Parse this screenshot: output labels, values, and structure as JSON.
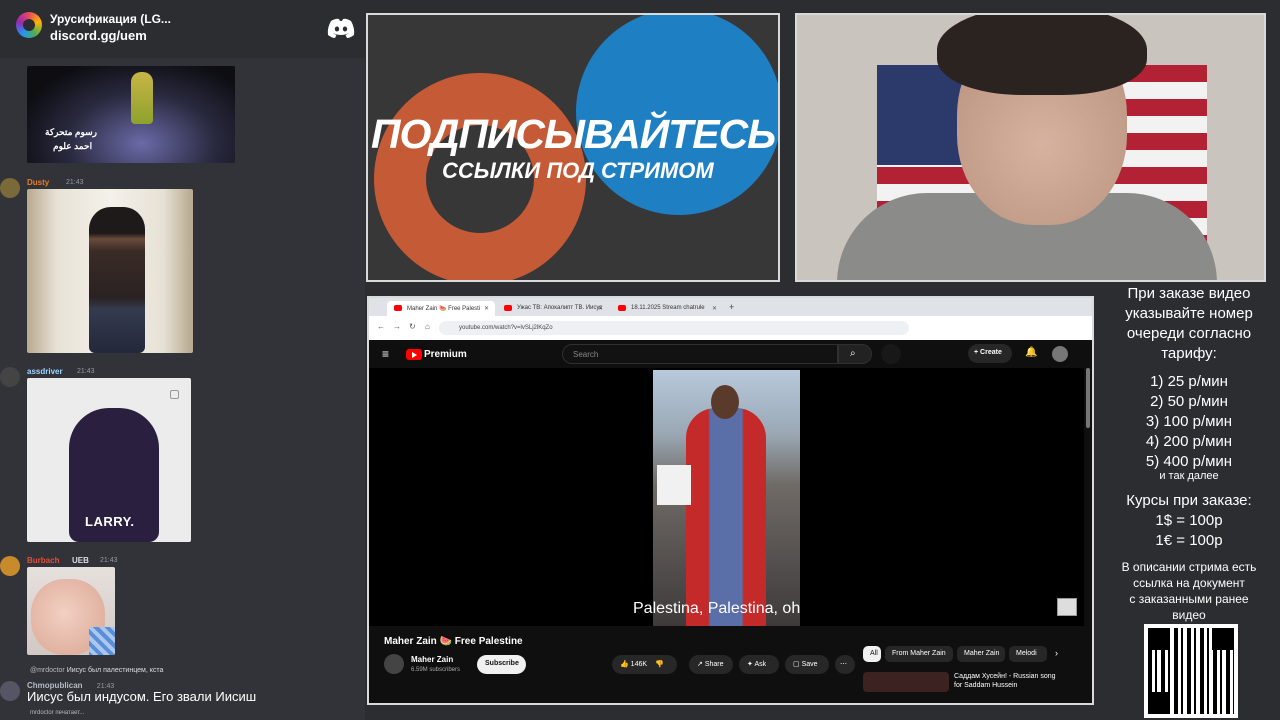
{
  "chat": {
    "server_name": "Урусификация (LG...",
    "server_invite": "discord.gg/uem",
    "messages": [
      {
        "author": "",
        "time": "",
        "image_caption_lines": [
          "رسوم متحركة",
          "احمد علوم"
        ]
      },
      {
        "author": "Dusty",
        "time": "21:43"
      },
      {
        "author": "assdriver",
        "time": "21:43",
        "image_caption": "LARRY."
      },
      {
        "author": "Burbach",
        "tag": "UEB",
        "time": "21:43"
      },
      {
        "reply_author": "@mrdoctor",
        "reply_text": "Иисус был палестинцем, кста",
        "author": "Chmopublican",
        "time": "21:43",
        "text": "Иисус был индусом. Его звали Иисиш"
      }
    ],
    "typing": "mrdoctor печатает..."
  },
  "promo": {
    "title": "ПОДПИСЫВАЙТЕСЬ",
    "subtitle": "ССЫЛКИ ПОД СТРИМОМ"
  },
  "browser": {
    "tabs": [
      {
        "label": "Maher Zain 🍉 Free Palesti"
      },
      {
        "label": "Ужас ТВ: Апокалипт ТВ. Иисус"
      },
      {
        "label": "18.11.2025 Stream chatrule"
      }
    ],
    "url": "youtube.com/watch?v=lvSLj2lKqZo",
    "youtube": {
      "brand": "Premium",
      "search_placeholder": "Search",
      "create_label": "Create",
      "subtitle": "Palestina, Palestina, oh",
      "video_title": "Maher Zain 🍉 Free Palestine",
      "channel_name": "Maher Zain",
      "subscribers": "6.59M subscribers",
      "subscribe_label": "Subscribe",
      "likes": "146K",
      "share_label": "Share",
      "ask_label": "Ask",
      "save_label": "Save",
      "chips": [
        "All",
        "From Maher Zain",
        "Maher Zain",
        "Melodi"
      ],
      "recommended_title": "Саддам Хусейн! - Russian song for Saddam Hussein"
    }
  },
  "info": {
    "order_lines": [
      "При заказе видео",
      "указывайте номер",
      "очереди согласно",
      "тарифу:"
    ],
    "tariffs": [
      "1) 25 р/мин",
      "2) 50 р/мин",
      "3) 100 р/мин",
      "4) 200 р/мин",
      "5) 400 р/мин"
    ],
    "and_so_on": "и так далее",
    "rates_title": "Курсы при заказе:",
    "rates": [
      "1$ = 100р",
      "1€ = 100р"
    ],
    "desc_lines": [
      "В описании стрима есть",
      "ссылка на документ",
      "с заказанными ранее",
      "видео"
    ]
  }
}
